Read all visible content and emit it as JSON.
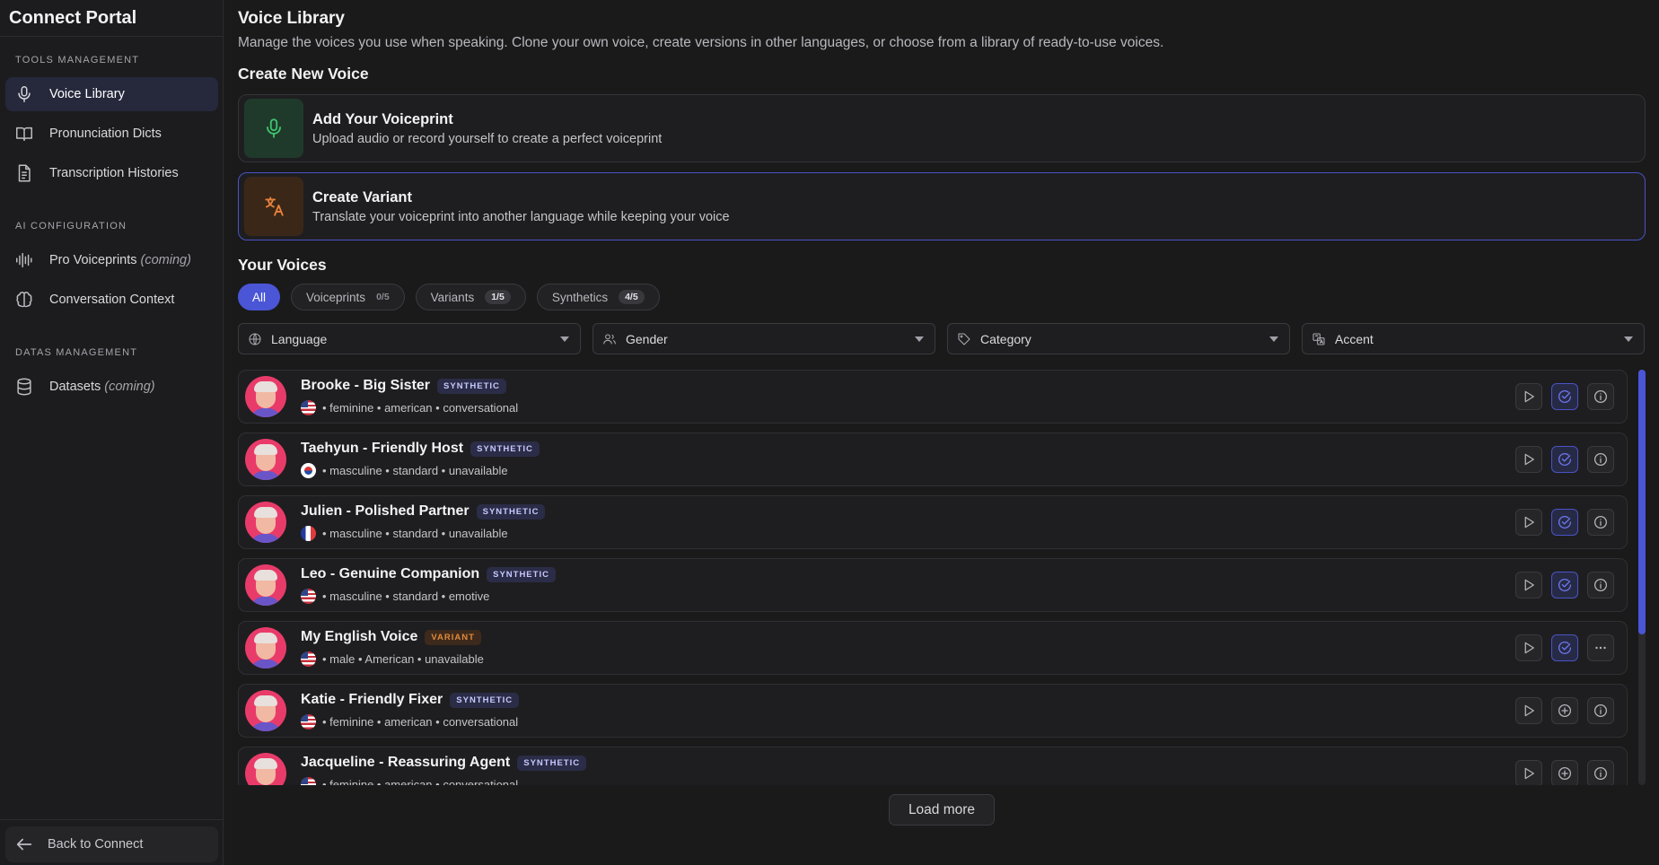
{
  "sidebar": {
    "app_title": "Connect Portal",
    "sections": [
      {
        "label": "TOOLS MANAGEMENT"
      },
      {
        "label": "AI CONFIGURATION"
      },
      {
        "label": "DATAS MANAGEMENT"
      }
    ],
    "items": [
      {
        "label": "Voice Library",
        "icon": "mic-icon",
        "active": true
      },
      {
        "label": "Pronunciation Dicts",
        "icon": "book-icon"
      },
      {
        "label": "Transcription Histories",
        "icon": "document-icon"
      },
      {
        "label": "Pro Voiceprints",
        "note": "(coming)",
        "icon": "waveform-icon"
      },
      {
        "label": "Conversation Context",
        "icon": "brain-icon"
      },
      {
        "label": "Datasets",
        "note": "(coming)",
        "icon": "database-icon"
      }
    ],
    "back_label": "Back to Connect"
  },
  "header": {
    "title": "Voice Library",
    "description": "Manage the voices you use when speaking. Clone your own voice, create versions in other languages, or choose from a library of ready-to-use voices."
  },
  "create": {
    "section_title": "Create New Voice",
    "cards": [
      {
        "title": "Add Your Voiceprint",
        "subtitle": "Upload audio or record yourself to create a perfect voiceprint",
        "icon": "mic-icon",
        "color": "#3ec46d"
      },
      {
        "title": "Create Variant",
        "subtitle": "Translate your voiceprint into another language while keeping your voice",
        "icon": "translate-icon",
        "color": "#e8823a"
      }
    ]
  },
  "voices": {
    "section_title": "Your Voices",
    "tabs": [
      {
        "label": "All",
        "active": true
      },
      {
        "label": "Voiceprints",
        "count": "0/5"
      },
      {
        "label": "Variants",
        "count": "1/5"
      },
      {
        "label": "Synthetics",
        "count": "4/5"
      }
    ],
    "filters": [
      {
        "label": "Language",
        "icon": "globe-icon"
      },
      {
        "label": "Gender",
        "icon": "users-icon"
      },
      {
        "label": "Category",
        "icon": "tag-icon"
      },
      {
        "label": "Accent",
        "icon": "translate-icon"
      }
    ],
    "list": [
      {
        "name": "Brooke - Big Sister",
        "badge": "SYNTHETIC",
        "flag": "us",
        "meta": "• feminine • american • conversational",
        "selected": true,
        "extra": "info"
      },
      {
        "name": "Taehyun - Friendly Host",
        "badge": "SYNTHETIC",
        "flag": "kr",
        "meta": "• masculine • standard • unavailable",
        "selected": true,
        "extra": "info"
      },
      {
        "name": "Julien - Polished Partner",
        "badge": "SYNTHETIC",
        "flag": "fr",
        "meta": "• masculine • standard • unavailable",
        "selected": true,
        "extra": "info"
      },
      {
        "name": "Leo - Genuine Companion",
        "badge": "SYNTHETIC",
        "flag": "us",
        "meta": "• masculine • standard • emotive",
        "selected": true,
        "extra": "info"
      },
      {
        "name": "My English Voice",
        "badge": "VARIANT",
        "flag": "us",
        "meta": "• male • American • unavailable",
        "selected": true,
        "extra": "more"
      },
      {
        "name": "Katie - Friendly Fixer",
        "badge": "SYNTHETIC",
        "flag": "us",
        "meta": "• feminine • american • conversational",
        "selected": false,
        "extra": "info"
      },
      {
        "name": "Jacqueline - Reassuring Agent",
        "badge": "SYNTHETIC",
        "flag": "us",
        "meta": "• feminine • american • conversational",
        "selected": false,
        "extra": "info"
      }
    ],
    "load_more": "Load more"
  },
  "colors": {
    "accent": "#4a56d6",
    "avatar": "#e93b6a"
  }
}
